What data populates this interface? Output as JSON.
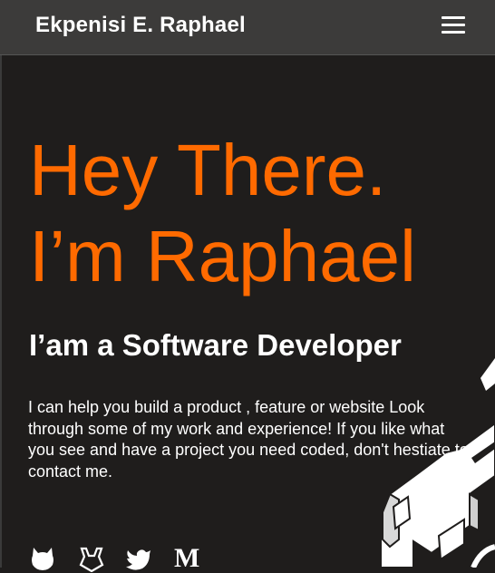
{
  "navbar": {
    "brand": "Ekpenisi E. Raphael",
    "menu_icon": "hamburger-menu-icon"
  },
  "hero": {
    "greeting_line1": "Hey There.",
    "greeting_line2": "I’m Raphael",
    "subtitle": "I’am a Software Developer",
    "bio": "I can help you build a product , feature or website Look through some of my work and experience! If you like what you see and have a project you need coded, don't hestiate to contact me."
  },
  "socials": [
    {
      "icon": "github-icon"
    },
    {
      "icon": "gitlab-icon"
    },
    {
      "icon": "twitter-icon"
    },
    {
      "icon": "medium-icon",
      "label": "M"
    }
  ],
  "colors": {
    "background": "#1f1d1c",
    "navbar": "#3c3b3a",
    "accent": "#ff6a00",
    "text": "#ffffff"
  }
}
